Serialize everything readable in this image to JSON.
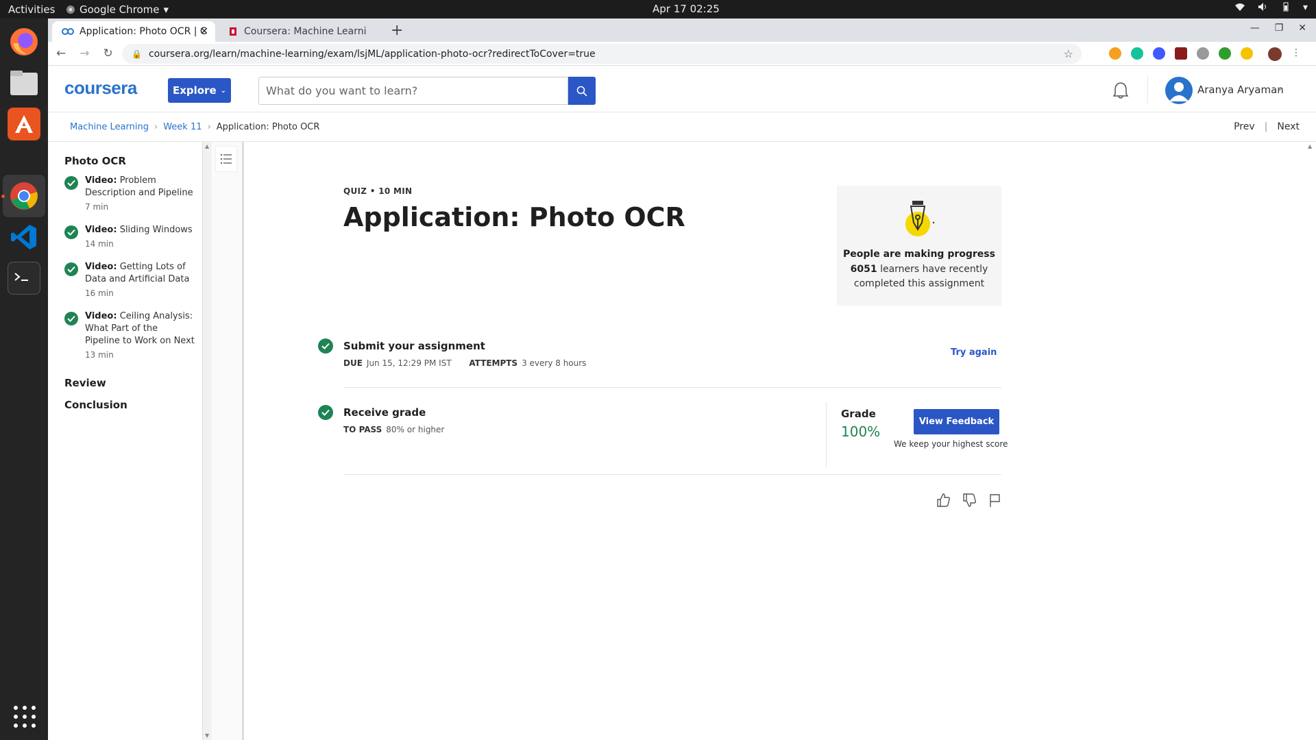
{
  "os": {
    "activities": "Activities",
    "app_name": "Google Chrome",
    "clock": "Apr 17  02:25"
  },
  "browser": {
    "tabs": [
      {
        "label": "Application: Photo OCR | C"
      },
      {
        "label": "Coursera: Machine Learni"
      }
    ],
    "url": "coursera.org/learn/machine-learning/exam/lsjML/application-photo-ocr?redirectToCover=true"
  },
  "header": {
    "logo": "coursera",
    "explore_label": "Explore",
    "search_placeholder": "What do you want to learn?",
    "user_name": "Aranya Aryaman"
  },
  "breadcrumb": {
    "items": [
      "Machine Learning",
      "Week 11",
      "Application: Photo OCR"
    ],
    "prev": "Prev",
    "next": "Next"
  },
  "sidebar": {
    "module": "Photo OCR",
    "items": [
      {
        "kind": "Video:",
        "title": "Problem Description and Pipeline",
        "duration": "7 min"
      },
      {
        "kind": "Video:",
        "title": "Sliding Windows",
        "duration": "14 min"
      },
      {
        "kind": "Video:",
        "title": "Getting Lots of Data and Artificial Data",
        "duration": "16 min"
      },
      {
        "kind": "Video:",
        "title": "Ceiling Analysis: What Part of the Pipeline to Work on Next",
        "duration": "13 min"
      }
    ],
    "sections": [
      "Review",
      "Conclusion"
    ]
  },
  "main": {
    "quiz_tag": "QUIZ • 10 MIN",
    "title": "Application: Photo OCR",
    "progress_card": {
      "heading": "People are making progress",
      "count": "6051",
      "text": "learners have recently completed this assignment"
    },
    "submit": {
      "title": "Submit your assignment",
      "due_label": "DUE",
      "due_value": "Jun 15, 12:29 PM IST",
      "attempts_label": "ATTEMPTS",
      "attempts_value": "3 every 8 hours",
      "try_again": "Try again"
    },
    "grade": {
      "title": "Receive grade",
      "pass_label": "TO PASS",
      "pass_value": "80% or higher",
      "grade_label": "Grade",
      "grade_value": "100%",
      "view_feedback": "View Feedback",
      "keep_note": "We keep your highest score"
    }
  },
  "colors": {
    "accent": "#2a56c6",
    "success": "#1f8354",
    "logo": "#2a73cc"
  }
}
